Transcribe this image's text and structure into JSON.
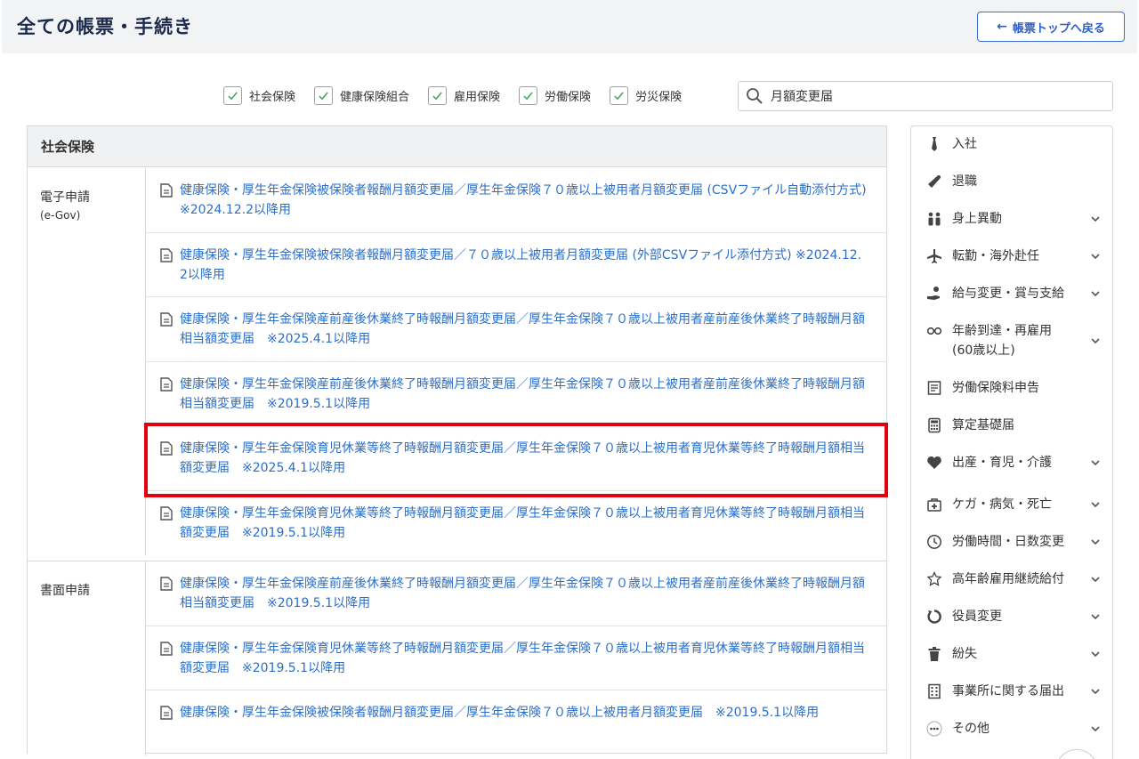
{
  "header": {
    "title": "全ての帳票・手続き",
    "back_label": "帳票トップへ戻る"
  },
  "filters": [
    {
      "label": "社会保険",
      "checked": true
    },
    {
      "label": "健康保険組合",
      "checked": true
    },
    {
      "label": "雇用保険",
      "checked": true
    },
    {
      "label": "労働保険",
      "checked": true
    },
    {
      "label": "労災保険",
      "checked": true
    }
  ],
  "search": {
    "value": "月額変更届"
  },
  "section": {
    "title": "社会保険",
    "groups": [
      {
        "label": "電子申請",
        "sublabel": "(e-Gov)",
        "rows": [
          "健康保険・厚生年金保険被保険者報酬月額変更届／厚生年金保険７０歳以上被用者月額変更届 (CSVファイル自動添付方式) ※2024.12.2以降用",
          "健康保険・厚生年金保険被保険者報酬月額変更届／７０歳以上被用者月額変更届 (外部CSVファイル添付方式) ※2024.12.2以降用",
          "健康保険・厚生年金保険産前産後休業終了時報酬月額変更届／厚生年金保険７０歳以上被用者産前産後休業終了時報酬月額相当額変更届　※2025.4.1以降用",
          "健康保険・厚生年金保険産前産後休業終了時報酬月額変更届／厚生年金保険７０歳以上被用者産前産後休業終了時報酬月額相当額変更届　※2019.5.1以降用",
          "健康保険・厚生年金保険育児休業等終了時報酬月額変更届／厚生年金保険７０歳以上被用者育児休業等終了時報酬月額相当額変更届　※2025.4.1以降用",
          "健康保険・厚生年金保険育児休業等終了時報酬月額変更届／厚生年金保険７０歳以上被用者育児休業等終了時報酬月額相当額変更届　※2019.5.1以降用"
        ]
      },
      {
        "label": "書面申請",
        "sublabel": "",
        "rows": [
          "健康保険・厚生年金保険産前産後休業終了時報酬月額変更届／厚生年金保険７０歳以上被用者産前産後休業終了時報酬月額相当額変更届　※2019.5.1以降用",
          "健康保険・厚生年金保険育児休業等終了時報酬月額変更届／厚生年金保険７０歳以上被用者育児休業等終了時報酬月額相当額変更届　※2019.5.1以降用",
          "健康保険・厚生年金保険被保険者報酬月額変更届／厚生年金保険７０歳以上被用者月額変更届　※2019.5.1以降用"
        ]
      }
    ]
  },
  "sidebar": {
    "items": [
      {
        "label": "入社",
        "icon": "necktie-icon",
        "expandable": false
      },
      {
        "label": "退職",
        "icon": "megaphone-icon",
        "expandable": false
      },
      {
        "label": "身上異動",
        "icon": "people-icon",
        "expandable": true
      },
      {
        "label": "転勤・海外赴任",
        "icon": "airplane-icon",
        "expandable": true
      },
      {
        "label": "給与変更・賞与支給",
        "icon": "hand-coin-icon",
        "expandable": true
      },
      {
        "label": "年齢到達・再雇用\n(60歳以上)",
        "icon": "glasses-icon",
        "expandable": true
      },
      {
        "label": "労働保険料申告",
        "icon": "document-lines-icon",
        "expandable": false
      },
      {
        "label": "算定基礎届",
        "icon": "calculator-icon",
        "expandable": false
      },
      {
        "label": "出産・育児・介護",
        "icon": "heart-icon",
        "expandable": true
      },
      {
        "label": "ケガ・病気・死亡",
        "icon": "first-aid-kit-icon",
        "expandable": true
      },
      {
        "label": "労働時間・日数変更",
        "icon": "clock-icon",
        "expandable": true
      },
      {
        "label": "高年齢雇用継続給付",
        "icon": "senior-mark-icon",
        "expandable": true
      },
      {
        "label": "役員変更",
        "icon": "cycle-icon",
        "expandable": true
      },
      {
        "label": "紛失",
        "icon": "trash-icon",
        "expandable": true
      },
      {
        "label": "事業所に関する届出",
        "icon": "building-icon",
        "expandable": true
      },
      {
        "label": "その他",
        "icon": "more-dots-icon",
        "expandable": true
      }
    ]
  },
  "colors": {
    "link": "#2b6fc9",
    "highlight_border": "#e50010",
    "title": "#1b2a4a",
    "checkbox_check": "#3aa35c"
  }
}
